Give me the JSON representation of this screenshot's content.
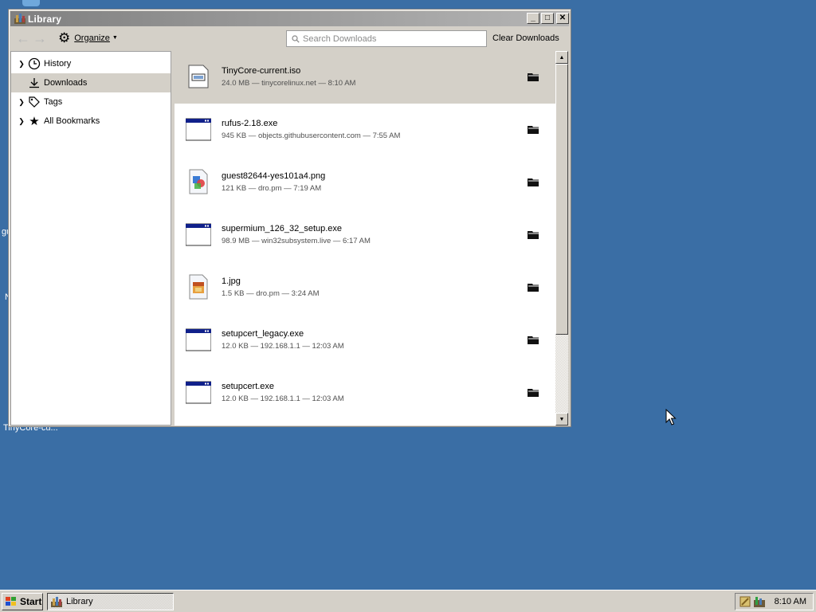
{
  "desktop": {
    "fragment_1": "gu",
    "fragment_2": "N",
    "caption": "TinyCore-cu..."
  },
  "window": {
    "title": "Library",
    "controls": {
      "minimize": "_",
      "maximize": "□",
      "close": "✕"
    }
  },
  "toolbar": {
    "organize_label": "Organize",
    "search_placeholder": "Search Downloads",
    "clear_label": "Clear Downloads"
  },
  "sidebar": {
    "items": [
      {
        "label": "History",
        "icon": "clock-icon",
        "expandable": true
      },
      {
        "label": "Downloads",
        "icon": "download-icon",
        "expandable": false,
        "selected": true
      },
      {
        "label": "Tags",
        "icon": "tag-icon",
        "expandable": true
      },
      {
        "label": "All Bookmarks",
        "icon": "star-icon",
        "expandable": true
      }
    ]
  },
  "downloads": [
    {
      "name": "TinyCore-current.iso",
      "status": "24.0 MB — tinycorelinux.net — 8:10 AM",
      "icon": "iso-file-icon",
      "selected": true
    },
    {
      "name": "rufus-2.18.exe",
      "status": "945 KB — objects.githubusercontent.com — 7:55 AM",
      "icon": "exe-file-icon"
    },
    {
      "name": "guest82644-yes101a4.png",
      "status": "121 KB — dro.pm — 7:19 AM",
      "icon": "png-file-icon"
    },
    {
      "name": "supermium_126_32_setup.exe",
      "status": "98.9 MB — win32subsystem.live — 6:17 AM",
      "icon": "exe-file-icon"
    },
    {
      "name": "1.jpg",
      "status": "1.5 KB — dro.pm — 3:24 AM",
      "icon": "jpg-file-icon"
    },
    {
      "name": "setupcert_legacy.exe",
      "status": "12.0 KB — 192.168.1.1 — 12:03 AM",
      "icon": "exe-file-icon"
    },
    {
      "name": "setupcert.exe",
      "status": "12.0 KB — 192.168.1.1 — 12:03 AM",
      "icon": "exe-file-icon"
    }
  ],
  "taskbar": {
    "start_label": "Start",
    "task_label": "Library",
    "clock": "8:10 AM"
  }
}
